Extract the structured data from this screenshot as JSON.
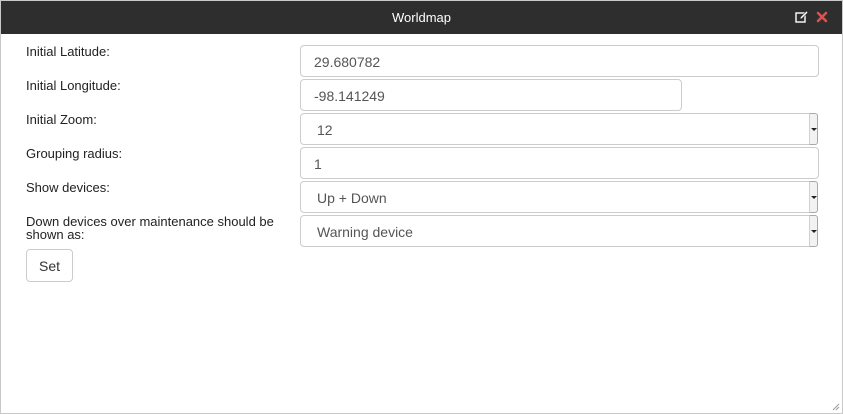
{
  "window": {
    "title": "Worldmap",
    "icons": {
      "edit": "edit-icon",
      "close": "close-icon"
    },
    "colors": {
      "titlebar": "#2e2e2e",
      "close": "#d9534f"
    }
  },
  "form": {
    "latitude_label": "Initial Latitude:",
    "latitude_value": "29.680782",
    "longitude_label": "Initial Longitude:",
    "longitude_value": "-98.141249",
    "zoom_label": "Initial Zoom:",
    "zoom_value": "12",
    "grouping_label": "Grouping radius:",
    "grouping_value": "1",
    "show_devices_label": "Show devices:",
    "show_devices_value": "Up + Down",
    "maintenance_label": "Down devices over maintenance should be shown as:",
    "maintenance_value": "Warning device",
    "set_label": "Set"
  }
}
